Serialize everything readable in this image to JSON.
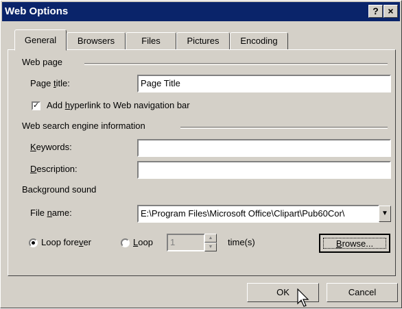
{
  "window": {
    "title": "Web Options",
    "help_glyph": "?",
    "close_glyph": "×"
  },
  "tabs": [
    {
      "label": "General"
    },
    {
      "label": "Browsers"
    },
    {
      "label": "Files"
    },
    {
      "label": "Pictures"
    },
    {
      "label": "Encoding"
    }
  ],
  "web_page": {
    "group_label": "Web page",
    "page_title": {
      "pre": "Page ",
      "accel": "t",
      "post": "itle:",
      "value": "Page Title"
    },
    "nav_checkbox": {
      "pre": "Add ",
      "accel": "h",
      "post": "yperlink to Web navigation bar",
      "checked_glyph": "✓"
    }
  },
  "search": {
    "group_label": "Web search engine information",
    "keywords": {
      "accel": "K",
      "post": "eywords:",
      "value": ""
    },
    "description": {
      "accel": "D",
      "post": "escription:",
      "value": ""
    }
  },
  "sound": {
    "group_label": "Background sound",
    "file_name": {
      "pre": "File ",
      "accel": "n",
      "post": "ame:",
      "value": "E:\\Program Files\\Microsoft Office\\Clipart\\Pub60Cor\\"
    },
    "loop_forever": {
      "pre": "Loop fore",
      "accel": "v",
      "post": "er"
    },
    "loop": {
      "accel": "L",
      "post": "oop"
    },
    "loop_count": "1",
    "times_label": "time(s)",
    "browse": {
      "accel": "B",
      "post": "rowse..."
    }
  },
  "buttons": {
    "ok": "OK",
    "cancel": "Cancel"
  },
  "glyphs": {
    "dropdown": "▼",
    "spin_up": "▲",
    "spin_down": "▼"
  }
}
